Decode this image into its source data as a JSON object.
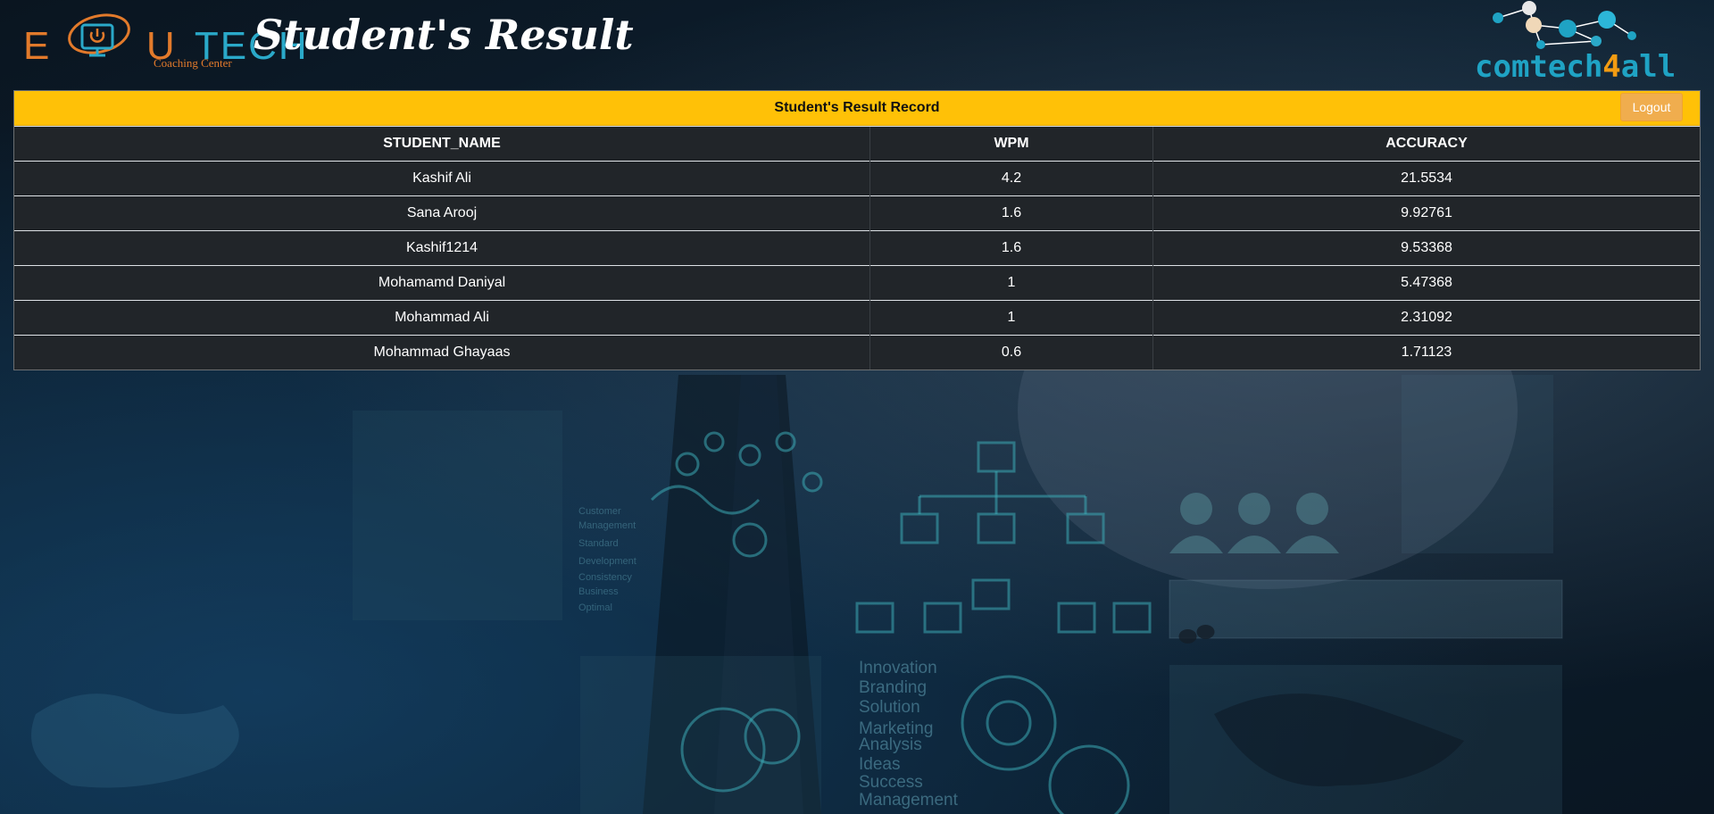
{
  "header": {
    "logo_left": {
      "letters": [
        "E",
        "U",
        "TECH"
      ],
      "subtitle": "Coaching Center"
    },
    "page_title": "Student's Result",
    "logo_right": {
      "text_main": "comtech",
      "text_accent": "4",
      "text_end": "all",
      "accent_color": "#f39c12",
      "brand_color": "#1fa3c4"
    }
  },
  "panel": {
    "title": "Student's Result Record",
    "logout_label": "Logout",
    "header_color": "#ffc107"
  },
  "table": {
    "columns": [
      "STUDENT_NAME",
      "WPM",
      "ACCURACY"
    ],
    "rows": [
      [
        "Kashif Ali",
        "4.2",
        "21.5534"
      ],
      [
        "Sana Arooj",
        "1.6",
        "9.92761"
      ],
      [
        "Kashif1214",
        "1.6",
        "9.53368"
      ],
      [
        "Mohamamd Daniyal",
        "1",
        "5.47368"
      ],
      [
        "Mohammad Ali",
        "1",
        "2.31092"
      ],
      [
        "Mohammad Ghayaas",
        "0.6",
        "1.71123"
      ]
    ]
  },
  "background_words": [
    "Customer",
    "Management",
    "Standard",
    "Development",
    "Consistency",
    "Business",
    "Optimal",
    "Innovation",
    "Branding",
    "Solution",
    "Marketing",
    "Analysis",
    "Ideas",
    "Success",
    "Management"
  ]
}
